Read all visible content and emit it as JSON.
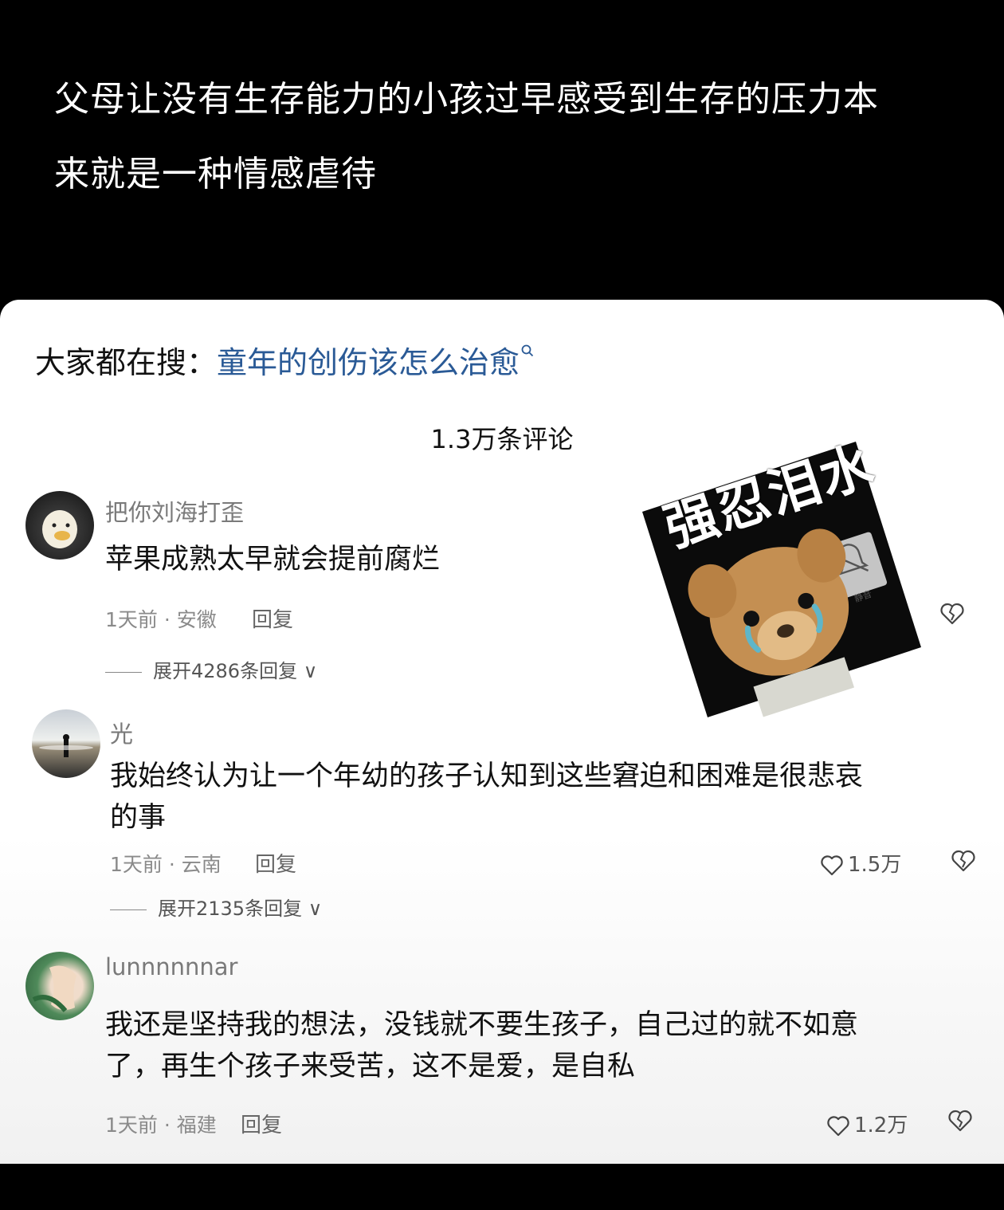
{
  "video": {
    "caption_line1": "父母让没有生存能力的小孩过早感受到生存的压力本",
    "caption_line2": "来就是一种情感虐待"
  },
  "search": {
    "prefix": "大家都在搜：",
    "keyword": "童年的创伤该怎么治愈"
  },
  "comments_header": {
    "title": "1.3万条评论"
  },
  "sticker": {
    "text": "强忍泪水",
    "badge_label": "静音"
  },
  "comments": [
    {
      "username": "把你刘海打歪",
      "text": "苹果成熟太早就会提前腐烂",
      "meta": "1天前 · 安徽",
      "reply_label": "回复",
      "expand_label": "展开4286条回复 ∨"
    },
    {
      "username": "光",
      "text_line1": "我始终认为让一个年幼的孩子认知到这些窘迫和困难是很悲哀",
      "text_line2": "的事",
      "meta": "1天前 · 云南",
      "reply_label": "回复",
      "like_count": "1.5万",
      "expand_label": "展开2135条回复 ∨"
    },
    {
      "username": "lunnnnnnar",
      "text_line1": "我还是坚持我的想法，没钱就不要生孩子，自己过的就不如意",
      "text_line2": "了，再生个孩子来受苦，这不是爱，是自私",
      "meta": "1天前 · 福建",
      "reply_label": "回复",
      "like_count": "1.2万"
    }
  ],
  "colors": {
    "keyword": "#2a5a96",
    "background": "#000000",
    "sheet": "#ffffff"
  }
}
